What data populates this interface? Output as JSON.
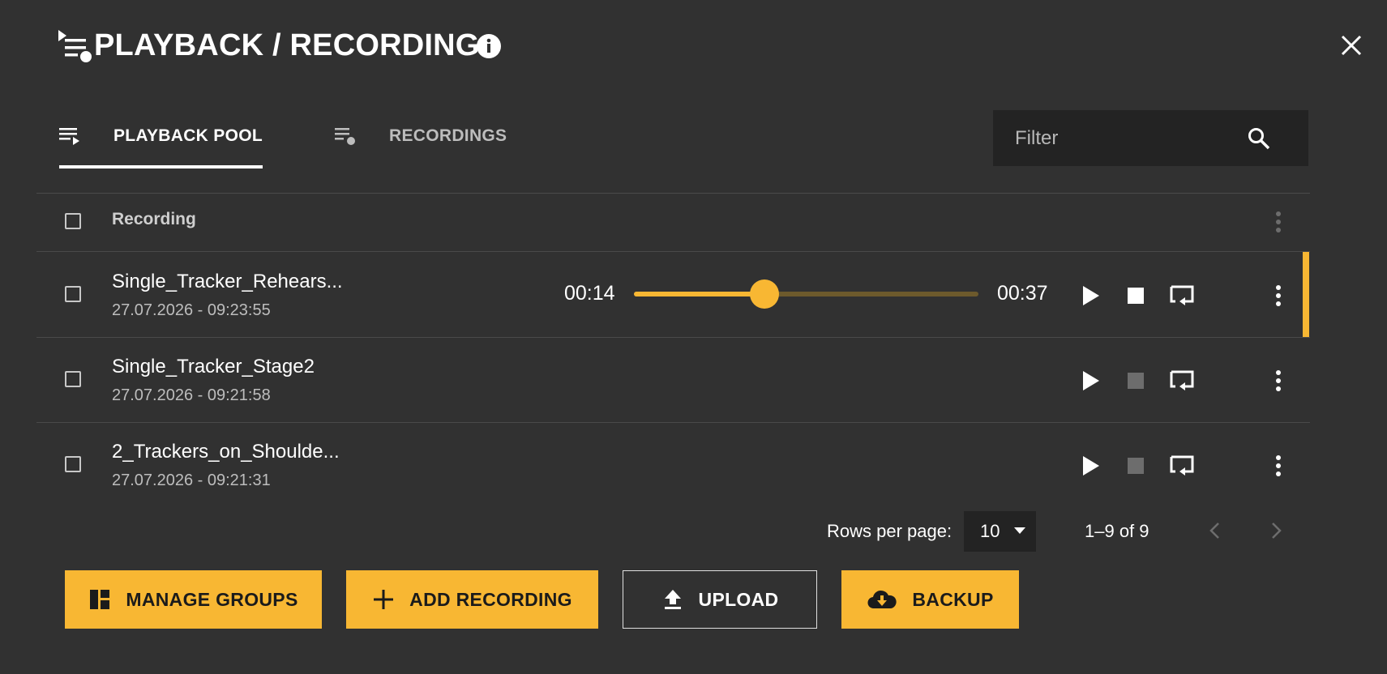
{
  "header": {
    "title": "PLAYBACK / RECORDING"
  },
  "tabs": [
    {
      "label": "PLAYBACK POOL",
      "active": true
    },
    {
      "label": "RECORDINGS",
      "active": false
    }
  ],
  "filter": {
    "placeholder": "Filter",
    "value": ""
  },
  "table": {
    "column_header": "Recording",
    "rows": [
      {
        "name": "Single_Tracker_Rehears...",
        "date": "27.07.2026 - 09:23:55",
        "playing": true,
        "elapsed": "00:14",
        "duration": "00:37",
        "progress": 0.378
      },
      {
        "name": "Single_Tracker_Stage2",
        "date": "27.07.2026 - 09:21:58",
        "playing": false
      },
      {
        "name": "2_Trackers_on_Shoulde...",
        "date": "27.07.2026 - 09:21:31",
        "playing": false
      }
    ]
  },
  "pagination": {
    "rows_per_page_label": "Rows per page:",
    "rows_per_page": "10",
    "range": "1–9 of 9"
  },
  "actions": {
    "manage_groups": "MANAGE GROUPS",
    "add_recording": "ADD RECORDING",
    "upload": "UPLOAD",
    "backup": "BACKUP"
  },
  "colors": {
    "accent": "#f8b733",
    "background": "#313131",
    "input_bg": "#232323"
  }
}
